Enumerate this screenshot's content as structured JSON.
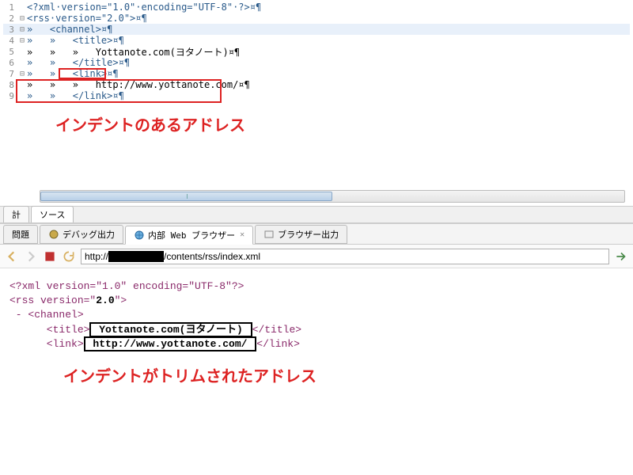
{
  "editor": {
    "lines": [
      {
        "n": "1",
        "fold": "",
        "content": "<?xml·version=\"1.0\"·encoding=\"UTF-8\"·?>¤¶"
      },
      {
        "n": "2",
        "fold": "⊟",
        "content": "<rss·version=\"2.0\">¤¶"
      },
      {
        "n": "3",
        "fold": "⊟",
        "content": "»   <channel>¤¶",
        "hl": true
      },
      {
        "n": "4",
        "fold": "⊟",
        "content": "»   »   <title>¤¶"
      },
      {
        "n": "5",
        "fold": "",
        "content": "»   »   »   Yottanote.com(ヨタノート)¤¶"
      },
      {
        "n": "6",
        "fold": "",
        "content": "»   »   </title>¤¶"
      },
      {
        "n": "7",
        "fold": "⊟",
        "content": "»   »   <link>¤¶"
      },
      {
        "n": "8",
        "fold": "",
        "content": "»   »   »   http://www.yottanote.com/¤¶"
      },
      {
        "n": "9",
        "fold": "",
        "content": "»   »   </link>¤¶"
      }
    ],
    "annotation": "インデントのあるアドレス"
  },
  "editor_tabs": {
    "left_truncated": "計",
    "source": "ソース"
  },
  "view_tabs": {
    "problems": "問題",
    "debug_output": "デバッグ出力",
    "internal_browser": "内部 Web ブラウザー",
    "browser_output": "ブラウザー出力"
  },
  "toolbar": {
    "url_prefix": "http://",
    "url_suffix": "/contents/rss/index.xml"
  },
  "browser": {
    "l1": "<?xml version=\"1.0\" encoding=\"UTF-8\"?>",
    "l2_a": "<rss version=\"",
    "l2_b": "2.0",
    "l2_c": "\">",
    "l3": " - <channel>",
    "l4_a": "      <title>",
    "l4_b": " Yottanote.com(ヨタノート) ",
    "l4_c": "</title>",
    "l5_a": "      <link>",
    "l5_b": " http://www.yottanote.com/ ",
    "l5_c": "</link>",
    "annotation": "インデントがトリムされたアドレス"
  }
}
